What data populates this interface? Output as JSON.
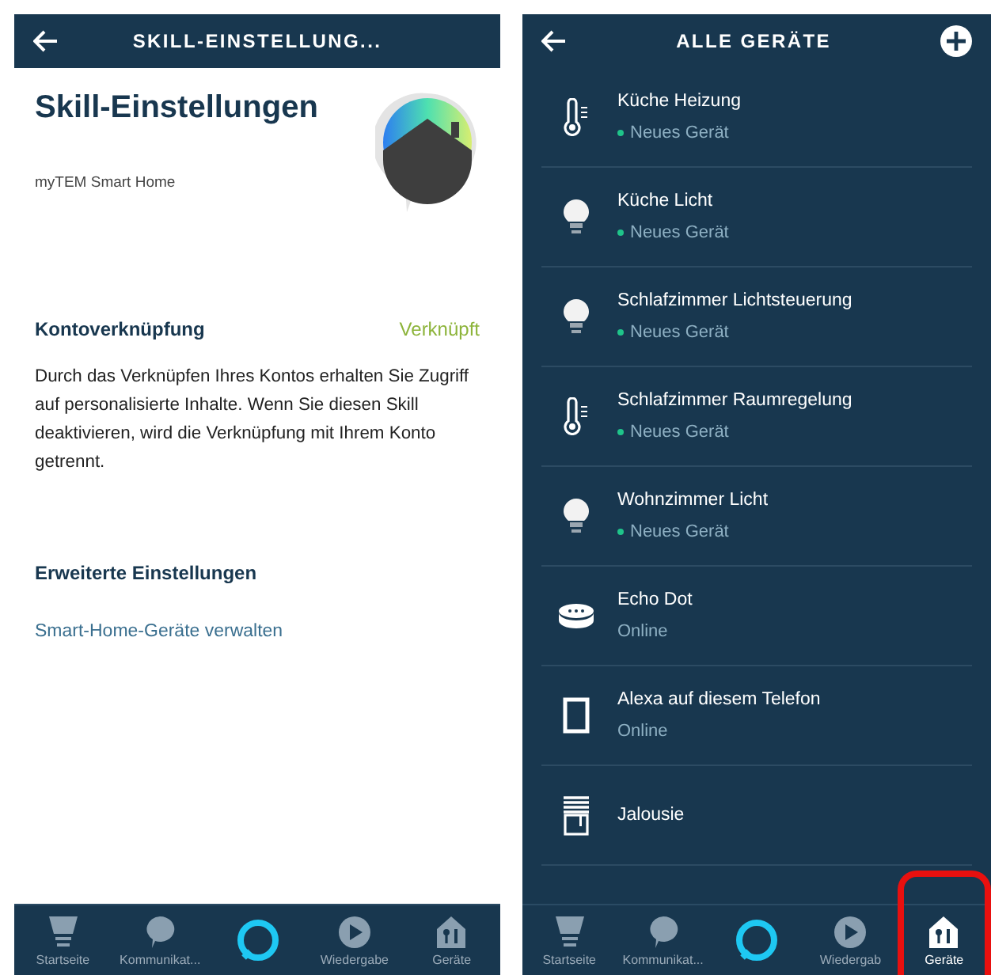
{
  "skill_screen": {
    "header": {
      "title": "SKILL-EINSTELLUNG..."
    },
    "title": "Skill-Einstellungen",
    "subtitle": "myTEM Smart Home",
    "account": {
      "label": "Kontoverknüpfung",
      "status": "Verknüpft",
      "linked": true,
      "description": "Durch das Verknüpfen Ihres Kontos erhalten Sie Zugriff auf personalisierte Inhalte. Wenn Sie diesen Skill deaktivieren, wird die Verknüpfung mit Ihrem Konto getrennt."
    },
    "advanced": {
      "label": "Erweiterte Einstellungen",
      "link": "Smart-Home-Geräte verwalten"
    },
    "nav": [
      {
        "kind": "home",
        "label": "Startseite",
        "selected": false
      },
      {
        "kind": "chat",
        "label": "Kommunikat...",
        "selected": false
      },
      {
        "kind": "alexa",
        "selected": false
      },
      {
        "kind": "play",
        "label": "Wiedergabe",
        "selected": false
      },
      {
        "kind": "devices",
        "label": "Geräte",
        "selected": false
      }
    ]
  },
  "devices_screen": {
    "header": {
      "title": "ALLE GERÄTE"
    },
    "devices": [
      {
        "kind": "thermostat",
        "name": "Küche Heizung",
        "status": "Neues Gerät",
        "new": true
      },
      {
        "kind": "bulb",
        "name": "Küche Licht",
        "status": "Neues Gerät",
        "new": true
      },
      {
        "kind": "bulb",
        "name": "Schlafzimmer Lichtsteuerung",
        "status": "Neues Gerät",
        "new": true
      },
      {
        "kind": "thermostat",
        "name": "Schlafzimmer Raumregelung",
        "status": "Neues Gerät",
        "new": true
      },
      {
        "kind": "bulb",
        "name": "Wohnzimmer Licht",
        "status": "Neues Gerät",
        "new": true
      },
      {
        "kind": "speaker",
        "name": "Echo Dot",
        "status": "Online",
        "new": false
      },
      {
        "kind": "phone",
        "name": "Alexa auf diesem Telefon",
        "status": "Online",
        "new": false
      },
      {
        "kind": "blind",
        "name": "Jalousie"
      }
    ],
    "nav": [
      {
        "kind": "home",
        "label": "Startseite",
        "selected": false,
        "highlighted": false
      },
      {
        "kind": "chat",
        "label": "Kommunikat...",
        "selected": false,
        "highlighted": false
      },
      {
        "kind": "alexa",
        "selected": false
      },
      {
        "kind": "play",
        "label": "Wiedergab",
        "selected": false,
        "highlighted": false
      },
      {
        "kind": "devices",
        "label": "Geräte",
        "selected": true,
        "highlighted": true
      }
    ]
  }
}
